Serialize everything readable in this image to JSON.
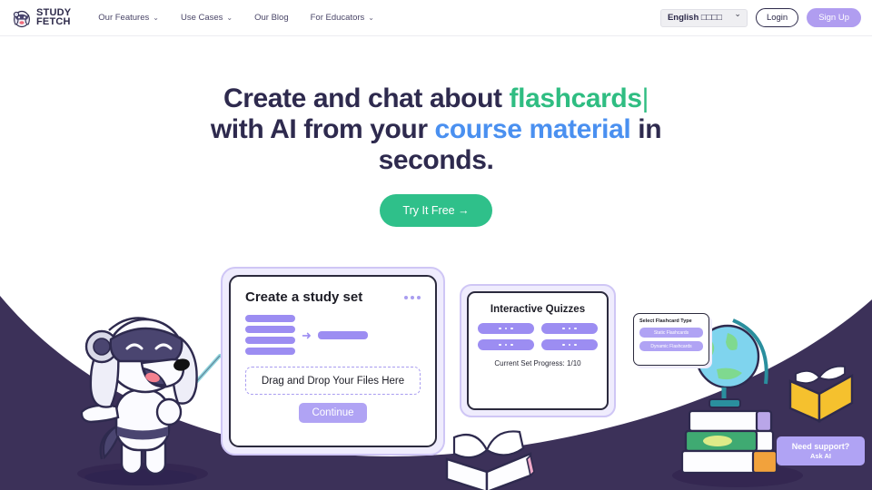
{
  "nav": {
    "logo": {
      "line1": "STUDY",
      "line2": "FETCH",
      "icon": "dog-mascot-icon"
    },
    "links": [
      {
        "label": "Our Features",
        "has_dropdown": true
      },
      {
        "label": "Use Cases",
        "has_dropdown": true
      },
      {
        "label": "Our Blog",
        "has_dropdown": false
      },
      {
        "label": "For Educators",
        "has_dropdown": true
      }
    ],
    "chevron": "⌄",
    "language": {
      "value": "English □□□□",
      "flag_glyph": "□"
    },
    "login_label": "Login",
    "signup_label": "Sign Up"
  },
  "hero": {
    "line1_pre": "Create and chat about ",
    "line1_kw": "flashcards",
    "caret": "|",
    "line2_pre": "with AI from your ",
    "line2_kw": "course material",
    "line2_post": " in",
    "line3": "seconds.",
    "cta_label": "Try It Free  →"
  },
  "study_card": {
    "title": "Create a study set",
    "menu_dots": "…",
    "arrow": "➜",
    "dropzone_label": "Drag and Drop Your Files Here",
    "continue_label": "Continue"
  },
  "quiz_card": {
    "title": "Interactive Quizzes",
    "progress_label": "Current Set Progress:",
    "progress_value": "1/10"
  },
  "type_card": {
    "title": "Select Flashcard Type",
    "options": [
      "Static Flashcards",
      "Dynamic Flashcards"
    ]
  },
  "support": {
    "title": "Need support?",
    "subtitle": "Ask AI"
  },
  "colors": {
    "brand_navy": "#2e2a4e",
    "accent_green": "#2fbd82",
    "accent_blue": "#4a90f0",
    "accent_purple": "#9c8df2",
    "signup_purple": "#b09df0",
    "bg_purple": "#3c3159"
  }
}
